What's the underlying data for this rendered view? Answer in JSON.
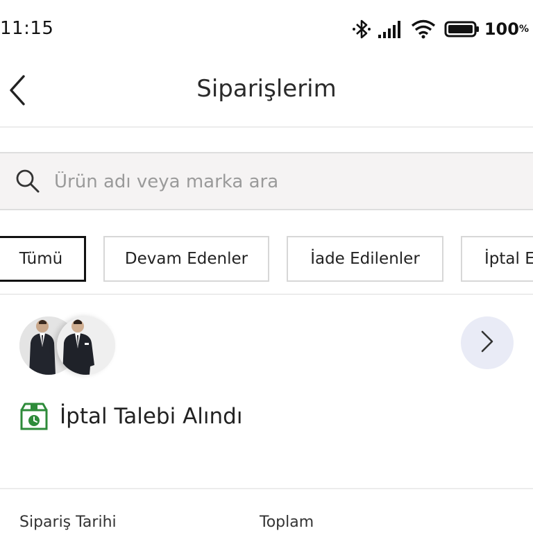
{
  "status_bar": {
    "time": "11:15",
    "battery_percent": "100",
    "battery_unit": "%",
    "icons": [
      "bluetooth-icon",
      "signal-icon",
      "wifi-icon",
      "battery-icon"
    ]
  },
  "header": {
    "title": "Siparişlerim",
    "back_icon": "chevron-left-icon"
  },
  "search": {
    "placeholder": "Ürün adı veya marka ara",
    "value": ""
  },
  "filters": {
    "chips": [
      {
        "label": "Tümü",
        "active": true
      },
      {
        "label": "Devam Edenler",
        "active": false
      },
      {
        "label": "İade Edilenler",
        "active": false
      },
      {
        "label": "İptal E",
        "active": false
      }
    ]
  },
  "order": {
    "status_text": "İptal Talebi Alındı",
    "status_icon": "box-clock-icon",
    "detail_icon": "chevron-right-icon",
    "product_images": [
      "suit-product-thumbnail",
      "suit-product-thumbnail"
    ],
    "summary_labels": {
      "date": "Sipariş Tarihi",
      "total": "Toplam"
    }
  },
  "colors": {
    "status_green": "#2e8b3a",
    "detail_button_bg": "#e9ebf6",
    "search_bg": "#f5f3f3"
  }
}
